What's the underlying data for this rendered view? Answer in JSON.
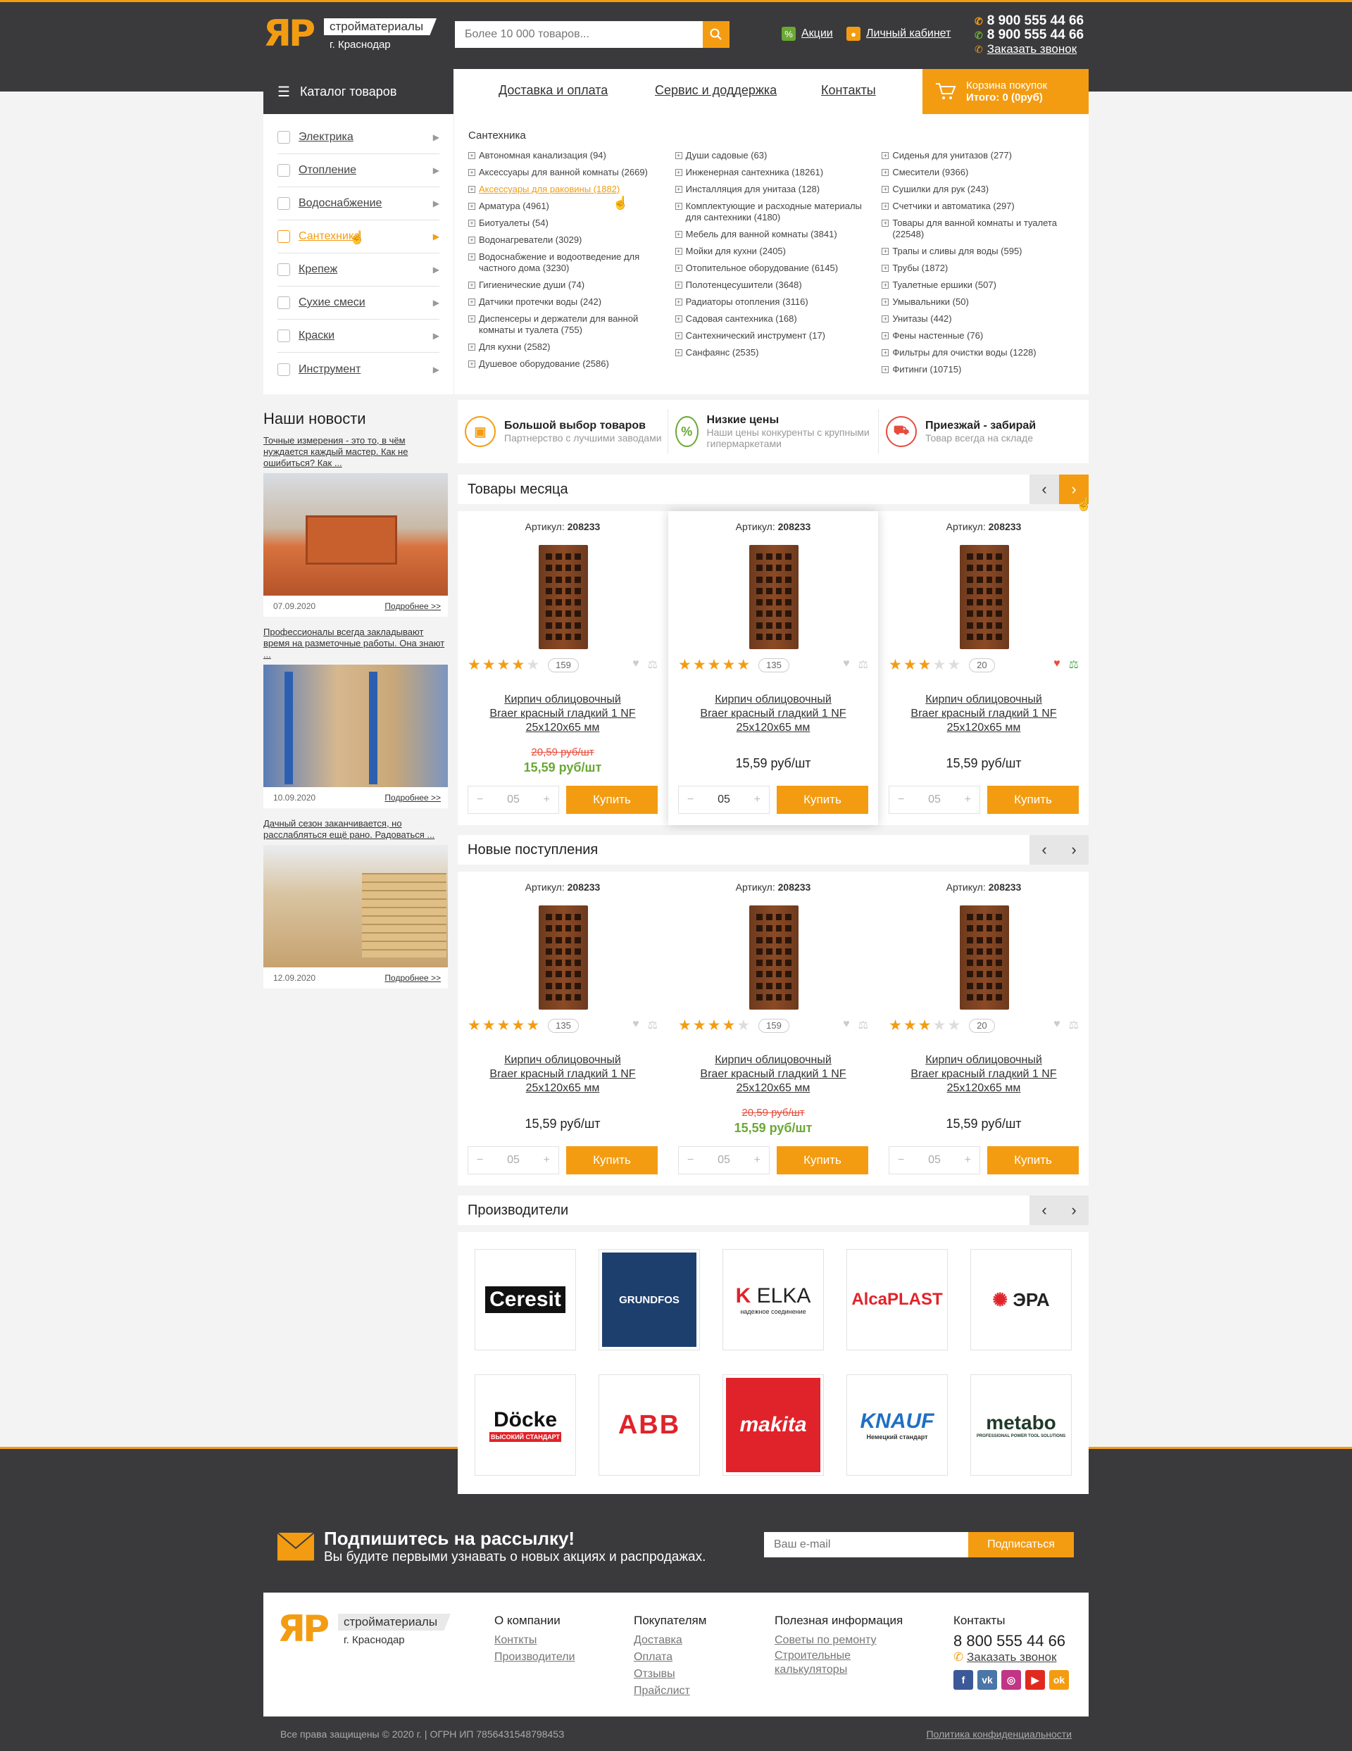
{
  "header": {
    "logo_mark": "ЯР",
    "logo_line1": "стройматериалы",
    "logo_line2": "г. Краснодар",
    "search_placeholder": "Более 10 000 товаров...",
    "promo": "Акции",
    "cabinet": "Личный кабинет",
    "phone1": "8 900 555 44 66",
    "phone2": "8 900 555 44 66",
    "callback": "Заказать звонок"
  },
  "nav": {
    "catalog": "Каталог товаров",
    "links": [
      "Доставка и оплата",
      "Сервис и доддержка",
      "Контакты"
    ],
    "cart_title": "Корзина покупок",
    "cart_total": "Итого: 0 (0руб)"
  },
  "sidemenu": [
    "Электрика",
    "Отопление",
    "Водоснабжение",
    "Сантехника",
    "Крепеж",
    "Сухие смеси",
    "Краски",
    "Инструмент"
  ],
  "submenu": {
    "title": "Сантехника",
    "col1": [
      "Автономная канализация (94)",
      "Аксессуары для ванной комнаты (2669)",
      "Аксессуары для раковины (1882)",
      "Арматура (4961)",
      "Биотуалеты (54)",
      "Водонагреватели (3029)",
      "Водоснабжение и водоотведение для частного дома (3230)",
      "Гигиенические души (74)",
      "Датчики протечки воды (242)",
      "Диспенсеры и держатели для ванной комнаты и туалета (755)",
      "Для кухни (2582)",
      "Душевое оборудование (2586)"
    ],
    "col2": [
      "Души садовые (63)",
      "Инженерная сантехника (18261)",
      "Инсталляция для унитаза (128)",
      "Комплектующие и расходные материалы для сантехники (4180)",
      "Мебель для ванной комнаты (3841)",
      "Мойки для кухни (2405)",
      "Отопительное оборудование (6145)",
      "Полотенцесушители (3648)",
      "Радиаторы отопления (3116)",
      "Садовая сантехника (168)",
      "Сантехнический инструмент (17)",
      "Санфаянс (2535)"
    ],
    "col3": [
      "Сиденья для унитазов (277)",
      "Смесители (9366)",
      "Сушилки для рук (243)",
      "Счетчики и автоматика (297)",
      "Товары для ванной комнаты и туалета (22548)",
      "Трапы и сливы для воды (595)",
      "Трубы (1872)",
      "Туалетные ершики (507)",
      "Умывальники (50)",
      "Унитазы (442)",
      "Фены настенные (76)",
      "Фильтры для очистки воды (1228)",
      "Фитинги (10715)"
    ]
  },
  "news": {
    "title": "Наши новости",
    "more": "Подробнее >>",
    "items": [
      {
        "caption": "Точные измерения - это то, в чём нуждается каждый мастер. Как не ошибиться? Как ...",
        "date": "07.09.2020"
      },
      {
        "caption": "Профессионалы всегда закладывают время на разметочные работы. Она знают ...",
        "date": "10.09.2020"
      },
      {
        "caption": "Дачный сезон заканчивается, но расслабляться ещё рано. Радоваться ...",
        "date": "12.09.2020"
      }
    ]
  },
  "features": [
    {
      "title": "Большой выбор товаров",
      "sub": "Партнерство с лучшими заводами",
      "icon": "box-icon",
      "color": "#f39c12"
    },
    {
      "title": "Низкие цены",
      "sub": "Наши цены конкуренты с крупными гипермаркетами",
      "icon": "percent-icon",
      "color": "#6aa834"
    },
    {
      "title": "Приезжай - забирай",
      "sub": "Товар всегда на складе",
      "icon": "truck-icon",
      "color": "#e74c3c"
    }
  ],
  "product_common": {
    "article_label": "Артикул:",
    "name_line1": "Кирпич облицовочный",
    "name_line2": "Braer красный гладкий 1 NF",
    "name_line3": "25х120х65 мм",
    "buy": "Купить"
  },
  "month": {
    "title": "Товары месяца",
    "items": [
      {
        "article": "208233",
        "stars": 4,
        "count": "159",
        "old": "20,59 руб/шт",
        "price": "15,59 руб/шт",
        "qty": "05"
      },
      {
        "article": "208233",
        "stars": 5,
        "count": "135",
        "old": "",
        "price": "15,59 руб/шт",
        "qty": "05"
      },
      {
        "article": "208233",
        "stars": 3,
        "count": "20",
        "old": "",
        "price": "15,59 руб/шт",
        "qty": "05"
      }
    ]
  },
  "new": {
    "title": "Новые поступления",
    "items": [
      {
        "article": "208233",
        "stars": 5,
        "count": "135",
        "old": "",
        "price": "15,59 руб/шт",
        "qty": "05"
      },
      {
        "article": "208233",
        "stars": 4,
        "count": "159",
        "old": "20,59 руб/шт",
        "price": "15,59 руб/шт",
        "qty": "05"
      },
      {
        "article": "208233",
        "stars": 3,
        "count": "20",
        "old": "",
        "price": "15,59 руб/шт",
        "qty": "05"
      }
    ]
  },
  "brands": {
    "title": "Производители",
    "items": [
      "Ceresit",
      "GRUNDFOS",
      "ELKA",
      "AlcaPLAST",
      "ЭРА",
      "Döcke",
      "ABB",
      "makita",
      "KNAUF",
      "metabo"
    ],
    "elka_sub": "надежное соединение",
    "docke_sub": "ВЫСОКИЙ СТАНДАРТ",
    "knauf_sub": "Немецкий стандарт",
    "metabo_sub": "PROFESSIONAL POWER TOOL SOLUTIONS"
  },
  "subscribe": {
    "title": "Подпишитесь на рассылку!",
    "sub": "Вы будите первыми узнавать о новых акциях и распродажах.",
    "placeholder": "Ваш e-mail",
    "button": "Подписаться"
  },
  "footer": {
    "col1_title": "О компании",
    "col1": [
      "Конткты",
      "Производители"
    ],
    "col2_title": "Покупателям",
    "col2": [
      "Доставка",
      "Оплата",
      "Отзывы",
      "Прайслист"
    ],
    "col3_title": "Полезная информация",
    "col3": [
      "Советы по ремонту",
      "Строительные калькуляторы"
    ],
    "col4_title": "Контакты",
    "phone": "8 800 555 44 66",
    "callback": "Заказать звонок",
    "copyright": "Все права защищены © 2020 г. | ОГРН ИП 785643154879845З",
    "policy": "Политика конфиденциальности"
  },
  "colors": {
    "accent": "#f39c12",
    "dark": "#3a3a3c",
    "green": "#6aa834",
    "red": "#e74c3c"
  }
}
